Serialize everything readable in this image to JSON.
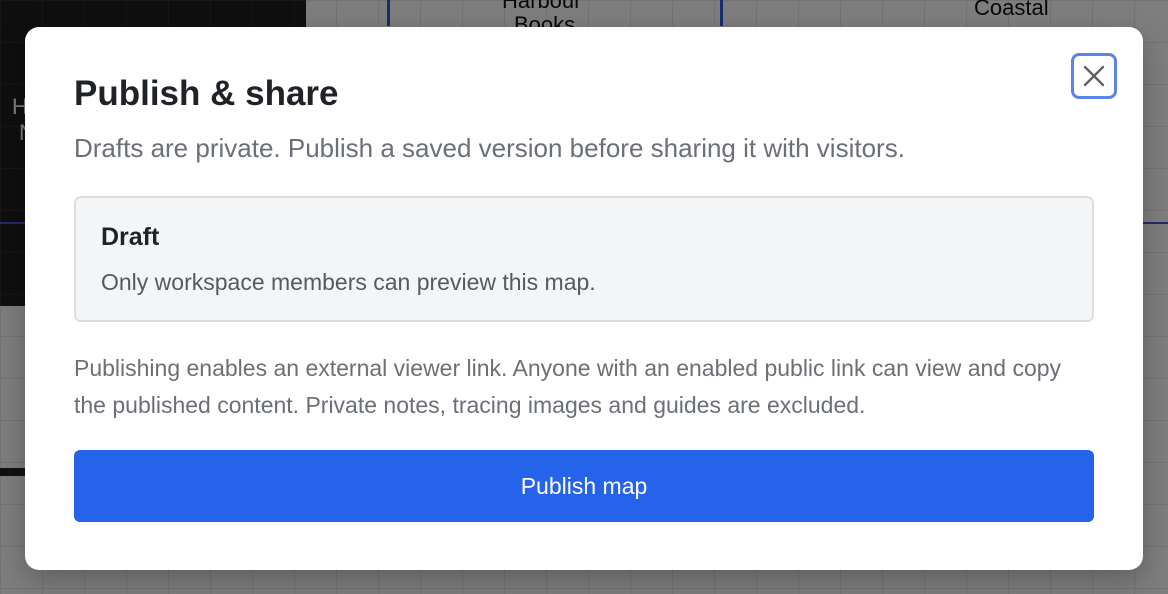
{
  "background": {
    "map_labels": [
      "Harbour",
      "Books",
      "Coastal",
      "H",
      "N"
    ]
  },
  "dialog": {
    "title": "Publish & share",
    "subtitle": "Drafts are private. Publish a saved version before sharing it with visitors.",
    "close_icon": "close-icon",
    "status": {
      "title": "Draft",
      "description": "Only workspace members can preview this map."
    },
    "info": "Publishing enables an external viewer link. Anyone with an enabled public link can view and copy the published content. Private notes, tracing images and guides are excluded.",
    "publish_label": "Publish map"
  },
  "colors": {
    "accent": "#2563eb",
    "focus_ring": "#5c83e8",
    "title_text": "#1f2328",
    "muted_text": "#6b6f76"
  }
}
